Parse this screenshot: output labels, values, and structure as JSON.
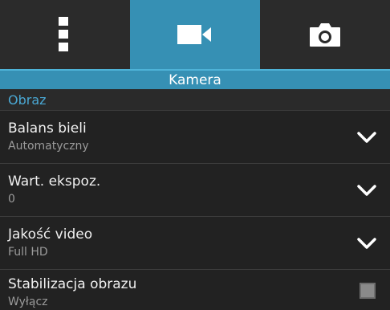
{
  "tabs": [
    {
      "icon": "more-vertical-icon",
      "active": false
    },
    {
      "icon": "video-camera-icon",
      "active": true
    },
    {
      "icon": "camera-icon",
      "active": false
    }
  ],
  "header": {
    "title": "Kamera"
  },
  "section": {
    "title": "Obraz"
  },
  "settings": [
    {
      "title": "Balans bieli",
      "value": "Automatyczny",
      "control": "dropdown"
    },
    {
      "title": "Wart. ekspoz.",
      "value": "0",
      "control": "dropdown"
    },
    {
      "title": "Jakość video",
      "value": "Full HD",
      "control": "dropdown"
    },
    {
      "title": "Stabilizacja obrazu",
      "value": "Wyłącz",
      "control": "checkbox",
      "checked": false
    }
  ],
  "colors": {
    "accent": "#3690b4",
    "section_text": "#4aa8d4",
    "background": "#222222"
  }
}
